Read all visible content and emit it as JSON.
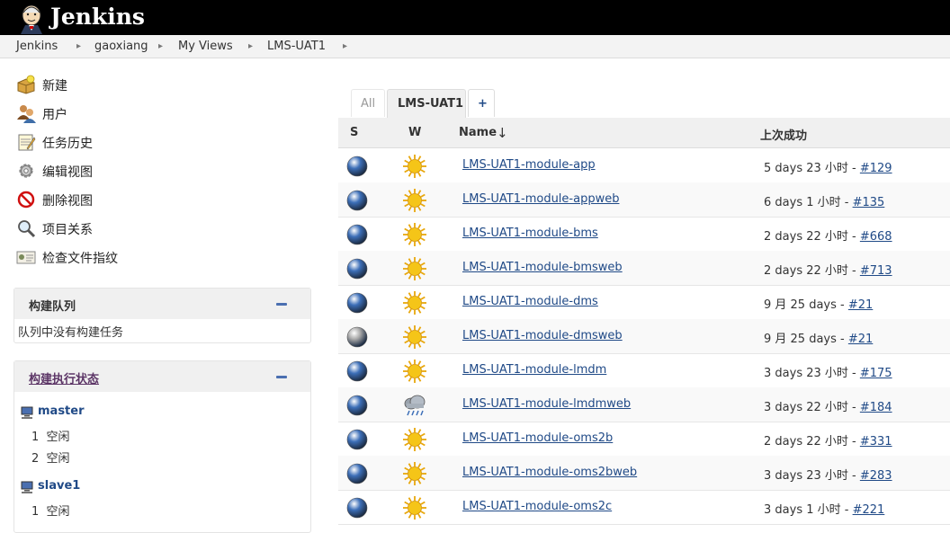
{
  "header": {
    "brand": "Jenkins",
    "logo_icon": "jenkins-butler-logo"
  },
  "breadcrumb": [
    "Jenkins",
    "gaoxiang",
    "My Views",
    "LMS-UAT1"
  ],
  "breadcrumb_separator": "▸",
  "tasks": [
    {
      "label": "新建",
      "icon": "new-package-icon"
    },
    {
      "label": "用户",
      "icon": "users-icon"
    },
    {
      "label": "任务历史",
      "icon": "notepad-icon"
    },
    {
      "label": "编辑视图",
      "icon": "gear-icon"
    },
    {
      "label": "删除视图",
      "icon": "no-entry-icon"
    },
    {
      "label": "项目关系",
      "icon": "magnifier-icon"
    },
    {
      "label": "检查文件指纹",
      "icon": "fingerprint-icon"
    }
  ],
  "build_queue": {
    "title": "构建队列",
    "empty_message": "队列中没有构建任务"
  },
  "executors": {
    "title": "构建执行状态",
    "computers": [
      {
        "name": "master",
        "slots": [
          {
            "num": "1",
            "state": "空闲"
          },
          {
            "num": "2",
            "state": "空闲"
          }
        ]
      },
      {
        "name": "slave1",
        "slots": [
          {
            "num": "1",
            "state": "空闲"
          }
        ]
      }
    ]
  },
  "tabs": [
    {
      "label": "All",
      "active": false
    },
    {
      "label": "LMS-UAT1",
      "active": true
    },
    {
      "label": "+",
      "active": false
    }
  ],
  "table": {
    "headers": {
      "s": "S",
      "w": "W",
      "name": "Name",
      "sort_arrow": "↓",
      "last_success": "上次成功"
    },
    "rows": [
      {
        "name": "LMS-UAT1-module-app",
        "status": "blue",
        "weather": "sunny",
        "last_text": "5 days 23 小时 - ",
        "build": "#129"
      },
      {
        "name": "LMS-UAT1-module-appweb",
        "status": "blue",
        "weather": "sunny",
        "last_text": "6 days 1 小时 - ",
        "build": "#135"
      },
      {
        "name": "LMS-UAT1-module-bms",
        "status": "blue",
        "weather": "sunny",
        "last_text": "2 days 22 小时 - ",
        "build": "#668"
      },
      {
        "name": "LMS-UAT1-module-bmsweb",
        "status": "blue",
        "weather": "sunny",
        "last_text": "2 days 22 小时 - ",
        "build": "#713"
      },
      {
        "name": "LMS-UAT1-module-dms",
        "status": "blue",
        "weather": "sunny",
        "last_text": "9 月 25 days - ",
        "build": "#21"
      },
      {
        "name": "LMS-UAT1-module-dmsweb",
        "status": "grey",
        "weather": "sunny",
        "last_text": "9 月 25 days - ",
        "build": "#21"
      },
      {
        "name": "LMS-UAT1-module-lmdm",
        "status": "blue",
        "weather": "sunny",
        "last_text": "3 days 23 小时 - ",
        "build": "#175"
      },
      {
        "name": "LMS-UAT1-module-lmdmweb",
        "status": "blue",
        "weather": "rainy",
        "last_text": "3 days 22 小时 - ",
        "build": "#184"
      },
      {
        "name": "LMS-UAT1-module-oms2b",
        "status": "blue",
        "weather": "sunny",
        "last_text": "2 days 22 小时 - ",
        "build": "#331"
      },
      {
        "name": "LMS-UAT1-module-oms2bweb",
        "status": "blue",
        "weather": "sunny",
        "last_text": "3 days 23 小时 - ",
        "build": "#283"
      },
      {
        "name": "LMS-UAT1-module-oms2c",
        "status": "blue",
        "weather": "sunny",
        "last_text": "3 days 1 小时 - ",
        "build": "#221"
      }
    ]
  },
  "colors": {
    "header_bg": "#000000",
    "link": "#204a87",
    "blue_ball": "#3d6fb8",
    "grey_ball": "#a8a8a8",
    "sun": "#f5c518"
  }
}
